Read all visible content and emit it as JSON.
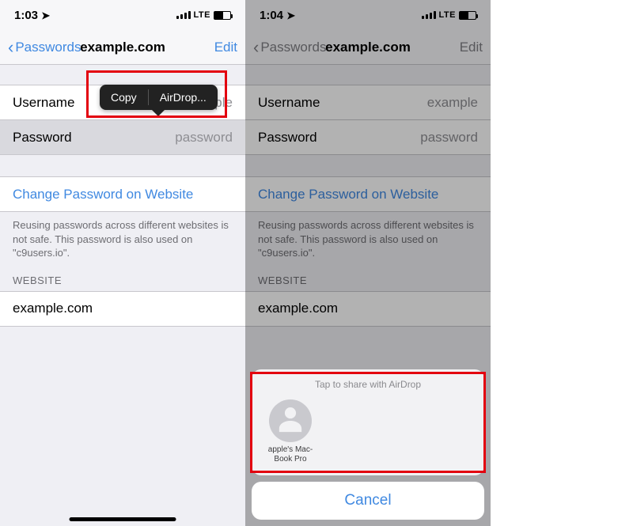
{
  "left": {
    "status": {
      "time": "1:03",
      "carrier": "LTE"
    },
    "nav": {
      "back": "Passwords",
      "title": "example.com",
      "edit": "Edit"
    },
    "rows": {
      "username_label": "Username",
      "username_value": "example",
      "password_label": "Password",
      "password_value": "password"
    },
    "link": "Change Password on Website",
    "help": "Reusing passwords across different websites is not safe. This password is also used on \"c9users.io\".",
    "section": "WEBSITE",
    "website": "example.com",
    "callout": {
      "copy": "Copy",
      "airdrop": "AirDrop..."
    }
  },
  "right": {
    "status": {
      "time": "1:04",
      "carrier": "LTE"
    },
    "nav": {
      "back": "Passwords",
      "title": "example.com",
      "edit": "Edit"
    },
    "rows": {
      "username_label": "Username",
      "username_value": "example",
      "password_label": "Password",
      "password_value": "password"
    },
    "link": "Change Password on Website",
    "help": "Reusing passwords across different websites is not safe. This password is also used on \"c9users.io\".",
    "section": "WEBSITE",
    "website": "example.com",
    "sheet": {
      "title": "Tap to share with AirDrop",
      "target": "apple's Mac-\nBook Pro",
      "cancel": "Cancel"
    }
  }
}
